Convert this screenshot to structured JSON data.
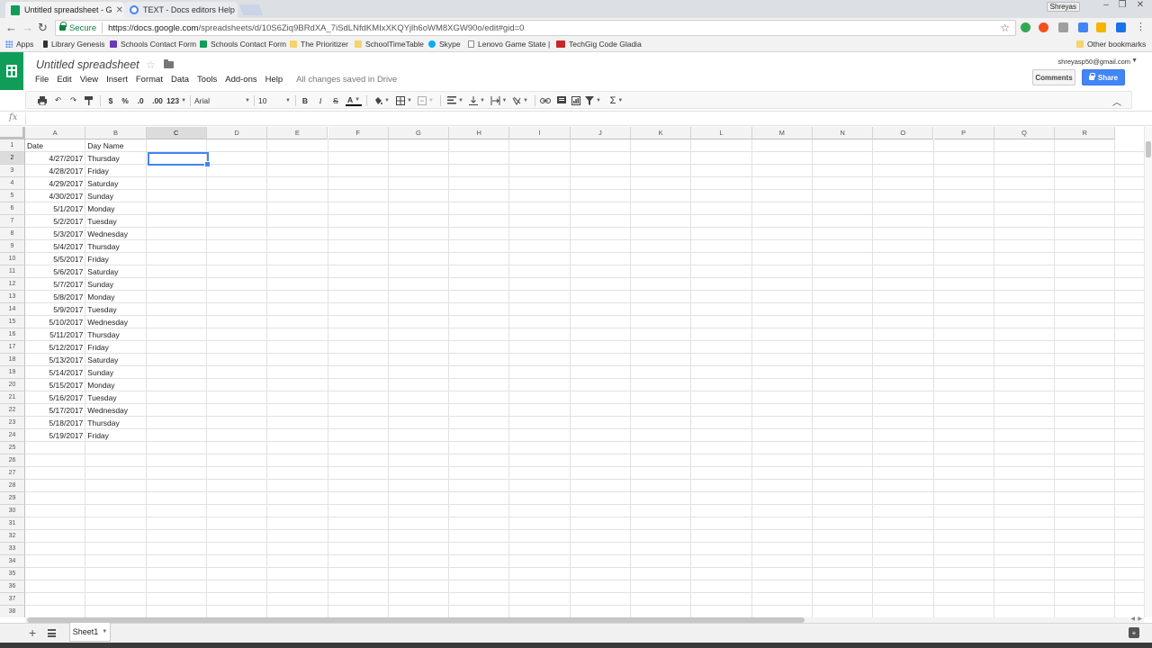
{
  "browser": {
    "tabs": [
      {
        "title": "Untitled spreadsheet - G",
        "active": true
      },
      {
        "title": "TEXT - Docs editors Help",
        "active": false
      }
    ],
    "profile_name": "Shreyas",
    "secure_label": "Secure",
    "url_host": "https://docs.google.com",
    "url_path": "/spreadsheets/d/10S6Ziq9BRdXA_7iSdLNfdKMIxXKQYjlh6oWM8XGW90o/edit#gid=0",
    "bookmarks": [
      {
        "label": "Apps",
        "icon": "apps-grid-icon"
      },
      {
        "label": "Library Genesis",
        "icon": "library-genesis-icon"
      },
      {
        "label": "Schools Contact Form",
        "icon": "forms-icon"
      },
      {
        "label": "Schools Contact Form",
        "icon": "sheets-icon"
      },
      {
        "label": "The Prioritizer",
        "icon": "folder-icon"
      },
      {
        "label": "SchoolTimeTable",
        "icon": "folder-icon"
      },
      {
        "label": "Skype",
        "icon": "skype-icon"
      },
      {
        "label": "Lenovo Game State |",
        "icon": "page-icon"
      },
      {
        "label": "TechGig Code Gladia",
        "icon": "techgig-icon"
      }
    ],
    "other_bookmarks": "Other bookmarks"
  },
  "sheets": {
    "doc_title": "Untitled spreadsheet",
    "menu": [
      "File",
      "Edit",
      "View",
      "Insert",
      "Format",
      "Data",
      "Tools",
      "Add-ons",
      "Help"
    ],
    "saved_status": "All changes saved in Drive",
    "account": "shreyasp50@gmail.com",
    "comments_label": "Comments",
    "share_label": "Share",
    "toolbar": {
      "currency": "$",
      "percent": "%",
      "decrease_decimal": ".0",
      "increase_decimal": ".00",
      "more_formats": "123",
      "font": "Arial",
      "font_size": "10",
      "bold": "B",
      "italic": "I",
      "strike": "S",
      "text_color": "A",
      "functions": "Σ"
    },
    "formula_icon": "fx",
    "columns": [
      "A",
      "B",
      "C",
      "D",
      "E",
      "F",
      "G",
      "H",
      "I",
      "J",
      "K",
      "L",
      "M",
      "N",
      "O",
      "P",
      "Q",
      "R"
    ],
    "row_count": 38,
    "selected_cell": "C2",
    "headers": [
      "Date",
      "Day Name"
    ],
    "rows": [
      [
        "4/27/2017",
        "Thursday"
      ],
      [
        "4/28/2017",
        "Friday"
      ],
      [
        "4/29/2017",
        "Saturday"
      ],
      [
        "4/30/2017",
        "Sunday"
      ],
      [
        "5/1/2017",
        "Monday"
      ],
      [
        "5/2/2017",
        "Tuesday"
      ],
      [
        "5/3/2017",
        "Wednesday"
      ],
      [
        "5/4/2017",
        "Thursday"
      ],
      [
        "5/5/2017",
        "Friday"
      ],
      [
        "5/6/2017",
        "Saturday"
      ],
      [
        "5/7/2017",
        "Sunday"
      ],
      [
        "5/8/2017",
        "Monday"
      ],
      [
        "5/9/2017",
        "Tuesday"
      ],
      [
        "5/10/2017",
        "Wednesday"
      ],
      [
        "5/11/2017",
        "Thursday"
      ],
      [
        "5/12/2017",
        "Friday"
      ],
      [
        "5/13/2017",
        "Saturday"
      ],
      [
        "5/14/2017",
        "Sunday"
      ],
      [
        "5/15/2017",
        "Monday"
      ],
      [
        "5/16/2017",
        "Tuesday"
      ],
      [
        "5/17/2017",
        "Wednesday"
      ],
      [
        "5/18/2017",
        "Thursday"
      ],
      [
        "5/19/2017",
        "Friday"
      ]
    ],
    "sheet_tabs": [
      "Sheet1"
    ]
  },
  "colors": {
    "sheets_green": "#0f9d58",
    "share_blue": "#4285f4",
    "selection_blue": "#4285f4"
  }
}
